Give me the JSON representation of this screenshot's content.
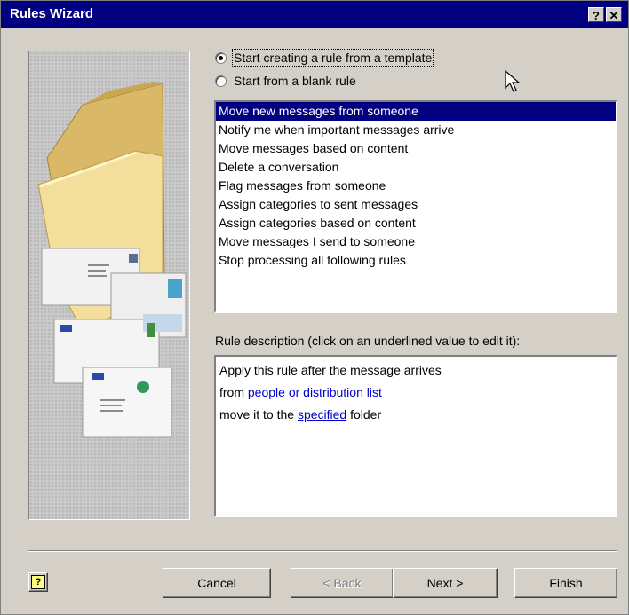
{
  "window": {
    "title": "Rules Wizard",
    "help_button": "?",
    "close_button": "✕"
  },
  "options": [
    {
      "label": "Start creating a rule from a template",
      "checked": true
    },
    {
      "label": "Start from a blank rule",
      "checked": false
    }
  ],
  "templates": {
    "items": [
      "Move new messages from someone",
      "Notify me when important messages arrive",
      "Move messages based on content",
      "Delete a conversation",
      "Flag messages from someone",
      "Assign categories to sent messages",
      "Assign categories based on content",
      "Move messages I send to someone",
      "Stop processing all following rules"
    ],
    "selected_index": 0
  },
  "description": {
    "label": "Rule description (click on an underlined value to edit it):",
    "line1": "Apply this rule after the message arrives",
    "line2_prefix": "from",
    "line2_link": "people or distribution list",
    "line3_prefix": "move it to the",
    "line3_link": "specified",
    "line3_suffix": "folder"
  },
  "buttons": {
    "help": "?",
    "cancel": "Cancel",
    "back": "< Back",
    "next": "Next >",
    "finish": "Finish"
  },
  "colors": {
    "title_bar": "#000080",
    "selection": "#000080",
    "link": "#0000cc",
    "face": "#d4d0c8"
  }
}
